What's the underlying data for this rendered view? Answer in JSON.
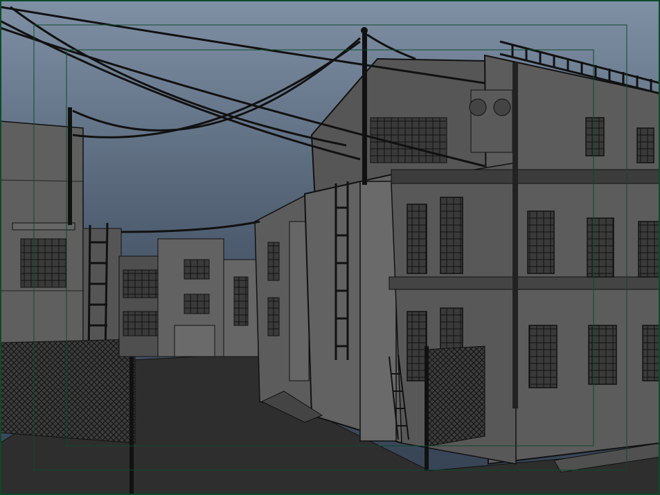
{
  "viewport": {
    "sky_top": "#7d8ea3",
    "sky_bottom": "#3f4e60",
    "ground": "#2f2f2f",
    "building_light": "#5e5e5e",
    "building_mid": "#4a4a4a",
    "building_dark": "#3a3a3a",
    "outline": "#111111",
    "frame": "#0d4a2a"
  }
}
